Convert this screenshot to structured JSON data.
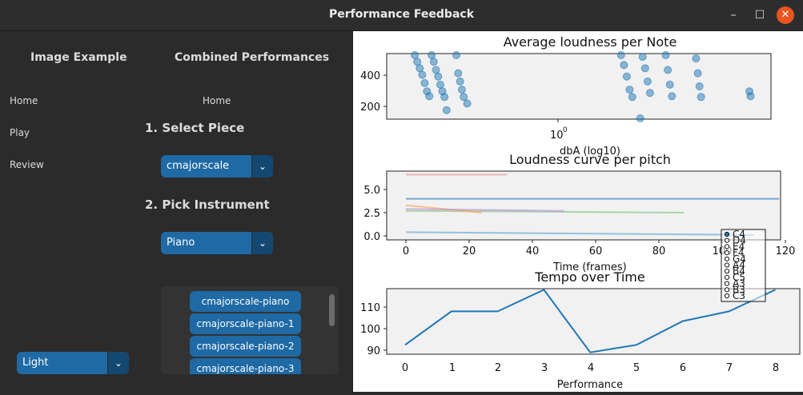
{
  "window": {
    "title": "Performance Feedback",
    "minimize": "–",
    "maximize": "☐",
    "close": "✕"
  },
  "left": {
    "image_example": "Image Example",
    "combined_title": "Combined Performances",
    "nav": [
      "Home",
      "Play",
      "Review"
    ],
    "home2": "Home",
    "step1": "1. Select Piece",
    "piece_value": "cmajorscale",
    "step2": "2. Pick Instrument",
    "instrument_value": "Piano",
    "list_items": [
      "cmajorscale-piano",
      "cmajorscale-piano-1",
      "cmajorscale-piano-2",
      "cmajorscale-piano-3"
    ],
    "theme_value": "Light",
    "chevron": "⌄"
  },
  "charts": {
    "colors": {
      "blue": "#1f77b4",
      "bg": "#f1f1f1"
    },
    "c1": {
      "title": "Average loudness per Note",
      "xlabel": "dbA (log10)",
      "xtick": "10",
      "xtick_exp": "0",
      "yticks": [
        "400",
        "200"
      ]
    },
    "c2": {
      "title": "Loudness curve per pitch",
      "xlabel": "Time (frames)",
      "xticks": [
        "0",
        "20",
        "40",
        "60",
        "80",
        "100",
        "120"
      ],
      "yticks": [
        "5.0",
        "2.5",
        "0.0"
      ],
      "legend": [
        "C4",
        "D4",
        "E4",
        "F4",
        "G4",
        "A4",
        "B4",
        "C5",
        "A3",
        "B3",
        "C3"
      ]
    },
    "c3": {
      "title": "Tempo over Time",
      "xlabel": "Performance",
      "xticks": [
        "0",
        "1",
        "2",
        "3",
        "4",
        "5",
        "6",
        "7",
        "8"
      ],
      "yticks": [
        "110",
        "100",
        "90"
      ]
    }
  },
  "chart_data": [
    {
      "type": "scatter",
      "title": "Average loudness per Note",
      "xlabel": "dbA (log10)",
      "ylabel": "",
      "xscale": "log",
      "ylim": [
        120,
        520
      ],
      "series": [
        {
          "points": [
            [
              0.55,
              510
            ],
            [
              0.56,
              470
            ],
            [
              0.57,
              430
            ],
            [
              0.58,
              390
            ],
            [
              0.59,
              340
            ],
            [
              0.6,
              290
            ],
            [
              0.61,
              260
            ],
            [
              0.62,
              510
            ],
            [
              0.63,
              470
            ],
            [
              0.64,
              420
            ],
            [
              0.65,
              380
            ],
            [
              0.66,
              330
            ],
            [
              0.67,
              290
            ],
            [
              0.68,
              255
            ],
            [
              0.69,
              175
            ],
            [
              0.74,
              510
            ],
            [
              0.75,
              400
            ],
            [
              0.76,
              350
            ],
            [
              0.77,
              300
            ],
            [
              0.78,
              255
            ],
            [
              0.8,
              215
            ],
            [
              2.4,
              510
            ],
            [
              2.45,
              450
            ],
            [
              2.5,
              380
            ],
            [
              2.55,
              300
            ],
            [
              2.6,
              255
            ],
            [
              2.8,
              500
            ],
            [
              2.85,
              430
            ],
            [
              2.9,
              350
            ],
            [
              2.95,
              280
            ],
            [
              3.3,
              510
            ],
            [
              3.35,
              420
            ],
            [
              3.4,
              330
            ],
            [
              3.45,
              260
            ],
            [
              4.1,
              490
            ],
            [
              4.15,
              400
            ],
            [
              4.2,
              320
            ],
            [
              4.25,
              255
            ],
            [
              6.0,
              290
            ],
            [
              6.05,
              260
            ],
            [
              2.75,
              125
            ]
          ]
        }
      ]
    },
    {
      "type": "line",
      "title": "Loudness curve per pitch",
      "xlabel": "Time (frames)",
      "ylabel": "",
      "ylim": [
        -0.5,
        7.5
      ],
      "series": [
        {
          "name": "C4",
          "x": [
            0,
            32
          ],
          "y": [
            6.6,
            6.6
          ]
        },
        {
          "name": "D4",
          "x": [
            0,
            118
          ],
          "y": [
            4.0,
            4.0
          ]
        },
        {
          "name": "E4",
          "x": [
            0,
            88
          ],
          "y": [
            2.7,
            2.5
          ]
        },
        {
          "name": "F4",
          "x": [
            0,
            24
          ],
          "y": [
            3.3,
            2.5
          ]
        },
        {
          "name": "G4",
          "x": [
            0,
            50
          ],
          "y": [
            2.9,
            2.7
          ]
        },
        {
          "name": "A4",
          "x": [
            0,
            110
          ],
          "y": [
            0.4,
            0.1
          ]
        }
      ]
    },
    {
      "type": "line",
      "title": "Tempo over Time",
      "xlabel": "Performance",
      "ylabel": "",
      "x": [
        0,
        1,
        2,
        3,
        4,
        5,
        6,
        7,
        8
      ],
      "series": [
        {
          "values": [
            92.5,
            108,
            108,
            118,
            89,
            92.5,
            103.5,
            108,
            118
          ]
        }
      ]
    }
  ]
}
